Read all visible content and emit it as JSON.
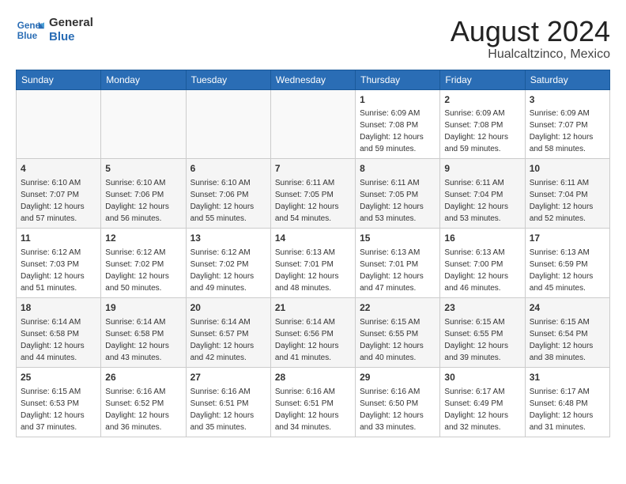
{
  "header": {
    "logo_line1": "General",
    "logo_line2": "Blue",
    "title": "August 2024",
    "subtitle": "Hualcaltzinco, Mexico"
  },
  "weekdays": [
    "Sunday",
    "Monday",
    "Tuesday",
    "Wednesday",
    "Thursday",
    "Friday",
    "Saturday"
  ],
  "weeks": [
    [
      {
        "day": "",
        "empty": true
      },
      {
        "day": "",
        "empty": true
      },
      {
        "day": "",
        "empty": true
      },
      {
        "day": "",
        "empty": true
      },
      {
        "day": "1",
        "sunrise": "6:09 AM",
        "sunset": "7:08 PM",
        "daylight": "12 hours and 59 minutes."
      },
      {
        "day": "2",
        "sunrise": "6:09 AM",
        "sunset": "7:08 PM",
        "daylight": "12 hours and 59 minutes."
      },
      {
        "day": "3",
        "sunrise": "6:09 AM",
        "sunset": "7:07 PM",
        "daylight": "12 hours and 58 minutes."
      }
    ],
    [
      {
        "day": "4",
        "sunrise": "6:10 AM",
        "sunset": "7:07 PM",
        "daylight": "12 hours and 57 minutes."
      },
      {
        "day": "5",
        "sunrise": "6:10 AM",
        "sunset": "7:06 PM",
        "daylight": "12 hours and 56 minutes."
      },
      {
        "day": "6",
        "sunrise": "6:10 AM",
        "sunset": "7:06 PM",
        "daylight": "12 hours and 55 minutes."
      },
      {
        "day": "7",
        "sunrise": "6:11 AM",
        "sunset": "7:05 PM",
        "daylight": "12 hours and 54 minutes."
      },
      {
        "day": "8",
        "sunrise": "6:11 AM",
        "sunset": "7:05 PM",
        "daylight": "12 hours and 53 minutes."
      },
      {
        "day": "9",
        "sunrise": "6:11 AM",
        "sunset": "7:04 PM",
        "daylight": "12 hours and 53 minutes."
      },
      {
        "day": "10",
        "sunrise": "6:11 AM",
        "sunset": "7:04 PM",
        "daylight": "12 hours and 52 minutes."
      }
    ],
    [
      {
        "day": "11",
        "sunrise": "6:12 AM",
        "sunset": "7:03 PM",
        "daylight": "12 hours and 51 minutes."
      },
      {
        "day": "12",
        "sunrise": "6:12 AM",
        "sunset": "7:02 PM",
        "daylight": "12 hours and 50 minutes."
      },
      {
        "day": "13",
        "sunrise": "6:12 AM",
        "sunset": "7:02 PM",
        "daylight": "12 hours and 49 minutes."
      },
      {
        "day": "14",
        "sunrise": "6:13 AM",
        "sunset": "7:01 PM",
        "daylight": "12 hours and 48 minutes."
      },
      {
        "day": "15",
        "sunrise": "6:13 AM",
        "sunset": "7:01 PM",
        "daylight": "12 hours and 47 minutes."
      },
      {
        "day": "16",
        "sunrise": "6:13 AM",
        "sunset": "7:00 PM",
        "daylight": "12 hours and 46 minutes."
      },
      {
        "day": "17",
        "sunrise": "6:13 AM",
        "sunset": "6:59 PM",
        "daylight": "12 hours and 45 minutes."
      }
    ],
    [
      {
        "day": "18",
        "sunrise": "6:14 AM",
        "sunset": "6:58 PM",
        "daylight": "12 hours and 44 minutes."
      },
      {
        "day": "19",
        "sunrise": "6:14 AM",
        "sunset": "6:58 PM",
        "daylight": "12 hours and 43 minutes."
      },
      {
        "day": "20",
        "sunrise": "6:14 AM",
        "sunset": "6:57 PM",
        "daylight": "12 hours and 42 minutes."
      },
      {
        "day": "21",
        "sunrise": "6:14 AM",
        "sunset": "6:56 PM",
        "daylight": "12 hours and 41 minutes."
      },
      {
        "day": "22",
        "sunrise": "6:15 AM",
        "sunset": "6:55 PM",
        "daylight": "12 hours and 40 minutes."
      },
      {
        "day": "23",
        "sunrise": "6:15 AM",
        "sunset": "6:55 PM",
        "daylight": "12 hours and 39 minutes."
      },
      {
        "day": "24",
        "sunrise": "6:15 AM",
        "sunset": "6:54 PM",
        "daylight": "12 hours and 38 minutes."
      }
    ],
    [
      {
        "day": "25",
        "sunrise": "6:15 AM",
        "sunset": "6:53 PM",
        "daylight": "12 hours and 37 minutes."
      },
      {
        "day": "26",
        "sunrise": "6:16 AM",
        "sunset": "6:52 PM",
        "daylight": "12 hours and 36 minutes."
      },
      {
        "day": "27",
        "sunrise": "6:16 AM",
        "sunset": "6:51 PM",
        "daylight": "12 hours and 35 minutes."
      },
      {
        "day": "28",
        "sunrise": "6:16 AM",
        "sunset": "6:51 PM",
        "daylight": "12 hours and 34 minutes."
      },
      {
        "day": "29",
        "sunrise": "6:16 AM",
        "sunset": "6:50 PM",
        "daylight": "12 hours and 33 minutes."
      },
      {
        "day": "30",
        "sunrise": "6:17 AM",
        "sunset": "6:49 PM",
        "daylight": "12 hours and 32 minutes."
      },
      {
        "day": "31",
        "sunrise": "6:17 AM",
        "sunset": "6:48 PM",
        "daylight": "12 hours and 31 minutes."
      }
    ]
  ]
}
